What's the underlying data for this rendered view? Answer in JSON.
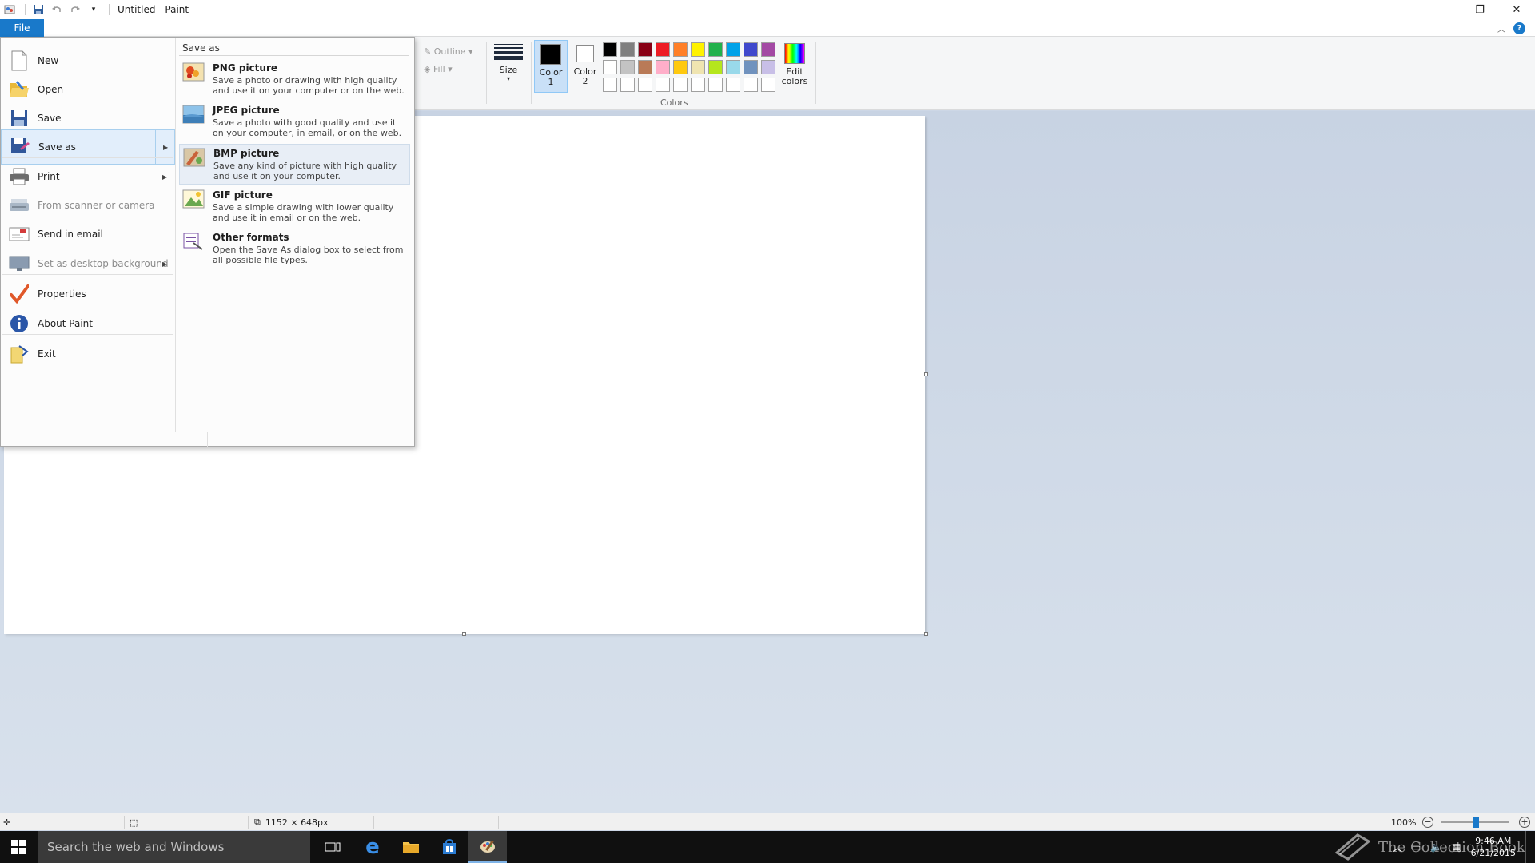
{
  "window": {
    "title": "Untitled - Paint",
    "controls": {
      "minimize": "—",
      "restore": "❐",
      "close": "✕"
    }
  },
  "ribbon": {
    "file_tab": "File",
    "outline_label": "Outline",
    "fill_label": "Fill",
    "size_label": "Size",
    "color1_label": "Color\n1",
    "color2_label": "Color\n2",
    "edit_colors_label": "Edit\ncolors",
    "colors_group_label": "Colors",
    "color1_value": "#000000",
    "color2_value": "#ffffff",
    "palette": [
      "#000000",
      "#7f7f7f",
      "#880015",
      "#ed1c24",
      "#ff7f27",
      "#fff200",
      "#22b14c",
      "#00a2e8",
      "#3f48cc",
      "#a349a4",
      "#ffffff",
      "#c3c3c3",
      "#b97a57",
      "#ffaec9",
      "#ffc90e",
      "#efe4b0",
      "#b5e61d",
      "#99d9ea",
      "#7092be",
      "#c8bfe7",
      "#ffffff",
      "#ffffff",
      "#ffffff",
      "#ffffff",
      "#ffffff",
      "#ffffff",
      "#ffffff",
      "#ffffff",
      "#ffffff",
      "#ffffff"
    ]
  },
  "file_menu": {
    "items": [
      {
        "label": "New",
        "icon": "new-file-icon",
        "disabled": false
      },
      {
        "label": "Open",
        "icon": "open-folder-icon",
        "disabled": false
      },
      {
        "label": "Save",
        "icon": "save-disk-icon",
        "disabled": false
      },
      {
        "label": "Save as",
        "icon": "save-as-icon",
        "disabled": false,
        "submenu": true,
        "selected": true
      },
      {
        "label": "Print",
        "icon": "printer-icon",
        "disabled": false,
        "submenu": true
      },
      {
        "label": "From scanner or camera",
        "icon": "scanner-icon",
        "disabled": true
      },
      {
        "label": "Send in email",
        "icon": "email-icon",
        "disabled": false
      },
      {
        "label": "Set as desktop background",
        "icon": "desktop-icon",
        "disabled": true,
        "submenu": true
      },
      {
        "label": "Properties",
        "icon": "checkmark-icon",
        "disabled": false
      },
      {
        "label": "About Paint",
        "icon": "info-icon",
        "disabled": false
      },
      {
        "label": "Exit",
        "icon": "exit-icon",
        "disabled": false
      }
    ],
    "submenu": {
      "header": "Save as",
      "items": [
        {
          "title": "PNG picture",
          "desc": "Save a photo or drawing with high quality and use it on your computer or on the web.",
          "icon": "png-icon"
        },
        {
          "title": "JPEG picture",
          "desc": "Save a photo with good quality and use it on your computer, in email, or on the web.",
          "icon": "jpeg-icon"
        },
        {
          "title": "BMP picture",
          "desc": "Save any kind of picture with high quality and use it on your computer.",
          "icon": "bmp-icon",
          "hover": true
        },
        {
          "title": "GIF picture",
          "desc": "Save a simple drawing with lower quality and use it in email or on the web.",
          "icon": "gif-icon"
        },
        {
          "title": "Other formats",
          "desc": "Open the Save As dialog box to select from all possible file types.",
          "icon": "other-formats-icon"
        }
      ]
    }
  },
  "statusbar": {
    "image_size": "1152 × 648px",
    "zoom": "100%",
    "zoom_level": 1.0
  },
  "taskbar": {
    "search_placeholder": "Search the web and Windows",
    "clock_time": "9:46 AM",
    "clock_date": "6/21/2015",
    "watermark": "The Collection Book"
  }
}
